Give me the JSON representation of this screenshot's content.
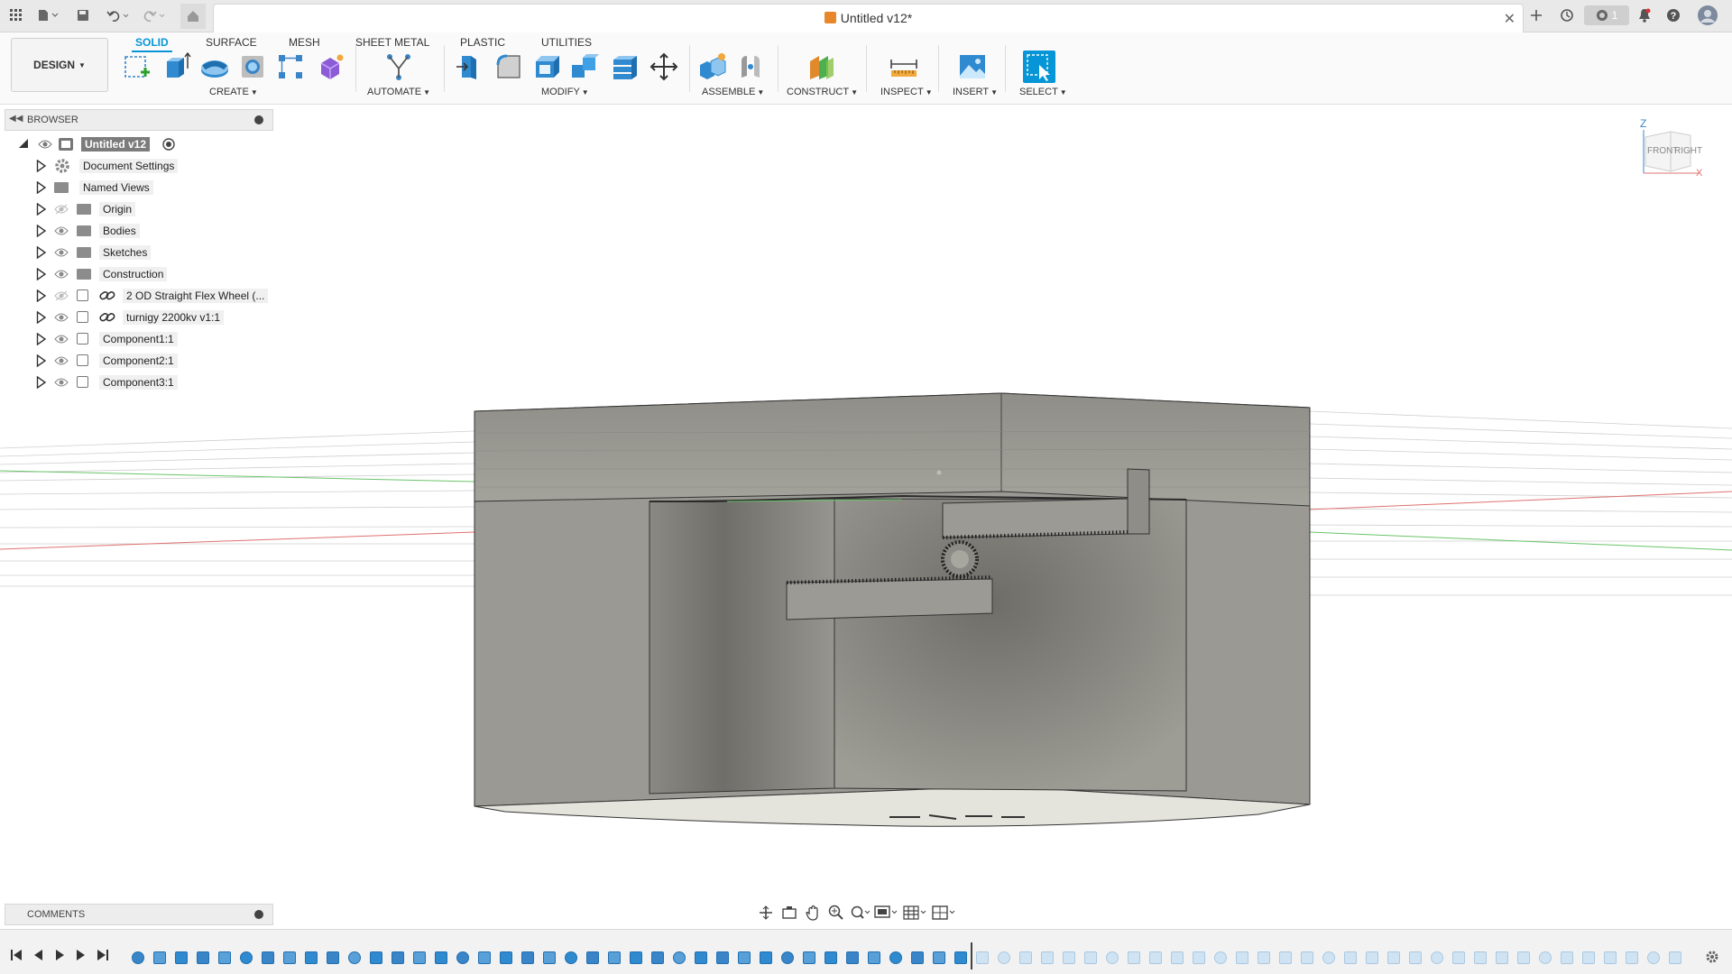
{
  "app": {
    "document_title": "Untitled v12*",
    "notification_count": "1"
  },
  "toolbar": {
    "workspace_label": "DESIGN",
    "tabs": [
      "SOLID",
      "SURFACE",
      "MESH",
      "SHEET METAL",
      "PLASTIC",
      "UTILITIES"
    ],
    "active_tab": "SOLID",
    "groups": {
      "create": "CREATE",
      "automate": "AUTOMATE",
      "modify": "MODIFY",
      "assemble": "ASSEMBLE",
      "construct": "CONSTRUCT",
      "inspect": "INSPECT",
      "insert": "INSERT",
      "select": "SELECT"
    }
  },
  "browser": {
    "title": "BROWSER",
    "root": "Untitled v12",
    "items": [
      {
        "label": "Document Settings",
        "icon": "gear-icon"
      },
      {
        "label": "Named Views",
        "icon": "folder-icon"
      },
      {
        "label": "Origin",
        "icon": "folder-icon",
        "hidden": true
      },
      {
        "label": "Bodies",
        "icon": "folder-icon"
      },
      {
        "label": "Sketches",
        "icon": "folder-icon"
      },
      {
        "label": "Construction",
        "icon": "folder-icon"
      },
      {
        "label": "2 OD Straight Flex Wheel (...",
        "icon": "component-icon",
        "linked": true,
        "hidden": true
      },
      {
        "label": "turnigy 2200kv v1:1",
        "icon": "component-icon",
        "linked": true
      },
      {
        "label": "Component1:1",
        "icon": "component-icon"
      },
      {
        "label": "Component2:1",
        "icon": "component-icon"
      },
      {
        "label": "Component3:1",
        "icon": "component-icon"
      }
    ]
  },
  "viewcube": {
    "axis_z": "Z",
    "axis_x": "X",
    "face_front": "FRONT",
    "face_right": "RIGHT"
  },
  "comments": {
    "title": "COMMENTS"
  },
  "colors": {
    "accent": "#0696d7",
    "model_face_light": "#9d9c95",
    "model_face_dark": "#6e6d68",
    "x_axis": "#e07070",
    "y_axis": "#6ac46a"
  }
}
